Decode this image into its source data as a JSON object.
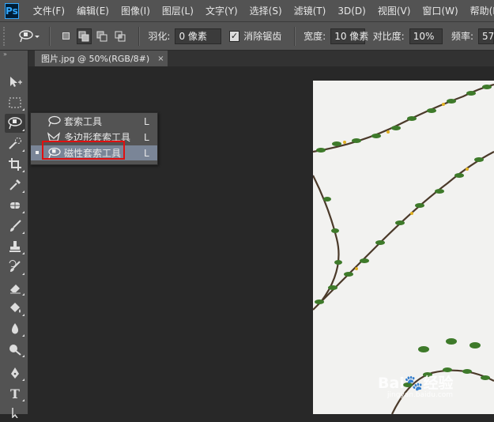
{
  "app": {
    "logo": "Ps"
  },
  "menu": [
    "文件(F)",
    "编辑(E)",
    "图像(I)",
    "图层(L)",
    "文字(Y)",
    "选择(S)",
    "滤镜(T)",
    "3D(D)",
    "视图(V)",
    "窗口(W)",
    "帮助(H)"
  ],
  "options": {
    "feather_label": "羽化:",
    "feather_value": "0 像素",
    "antialias_label": "消除锯齿",
    "antialias_checked": true,
    "width_label": "宽度:",
    "width_value": "10 像素",
    "contrast_label": "对比度:",
    "contrast_value": "10%",
    "frequency_label": "频率:",
    "frequency_value": "57"
  },
  "document": {
    "tab_title": "图片.jpg @ 50%(RGB/8#)",
    "close": "×"
  },
  "flyout": {
    "items": [
      {
        "label": "套索工具",
        "key": "L",
        "icon": "lasso-icon",
        "selected": false
      },
      {
        "label": "多边形套索工具",
        "key": "L",
        "icon": "polygonal-lasso-icon",
        "selected": false
      },
      {
        "label": "磁性套索工具",
        "key": "L",
        "icon": "magnetic-lasso-icon",
        "selected": true
      }
    ]
  },
  "toolbar": {
    "collapse": "»",
    "type_tool_glyph": "T",
    "tools": [
      "move-icon",
      "rect-marquee-icon",
      "lasso-icon",
      "quick-select-icon",
      "crop-icon",
      "eyedropper-icon",
      "healing-icon",
      "brush-icon",
      "stamp-icon",
      "history-brush-icon",
      "eraser-icon",
      "paint-bucket-icon",
      "blur-icon",
      "dodge-icon",
      "pen-icon",
      "type-icon",
      "path-select-icon"
    ]
  },
  "watermark": {
    "brand": "Bai",
    "brand2": "经验",
    "url": "jingyan.baidu.com"
  },
  "colors": {
    "accent_red": "#e01010",
    "selection": "#7a8597",
    "panel": "#535353",
    "canvas": "#282828"
  }
}
